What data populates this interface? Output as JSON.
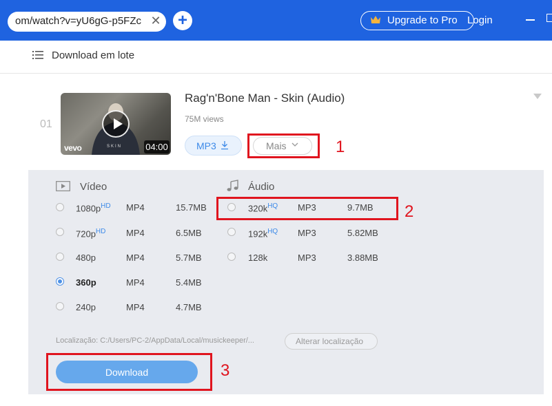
{
  "topbar": {
    "url": "om/watch?v=yU6gG-p5FZc",
    "close_glyph": "✕",
    "add_glyph": "+",
    "upgrade_label": "Upgrade to Pro",
    "login_label": "Login",
    "accent_color": "#1f63e0"
  },
  "batch": {
    "label": "Download em lote"
  },
  "item": {
    "index": "01",
    "title": "Rag'n'Bone Man - Skin (Audio)",
    "views": "75M views",
    "duration": "04:00",
    "thumb_brand": "vevo",
    "thumb_caption": "SKIN",
    "mp3_label": "MP3",
    "mais_label": "Mais"
  },
  "panel": {
    "video_header": "Vídeo",
    "audio_header": "Áudio",
    "video_rows": [
      {
        "quality": "1080p",
        "hq": "HD",
        "format": "MP4",
        "size": "15.7MB",
        "selected": false
      },
      {
        "quality": "720p",
        "hq": "HD",
        "format": "MP4",
        "size": "6.5MB",
        "selected": false
      },
      {
        "quality": "480p",
        "hq": "",
        "format": "MP4",
        "size": "5.7MB",
        "selected": false
      },
      {
        "quality": "360p",
        "hq": "",
        "format": "MP4",
        "size": "5.4MB",
        "selected": true
      },
      {
        "quality": "240p",
        "hq": "",
        "format": "MP4",
        "size": "4.7MB",
        "selected": false
      }
    ],
    "audio_rows": [
      {
        "quality": "320k",
        "hq": "HQ",
        "format": "MP3",
        "size": "9.7MB",
        "selected": false
      },
      {
        "quality": "192k",
        "hq": "HQ",
        "format": "MP3",
        "size": "5.82MB",
        "selected": false
      },
      {
        "quality": "128k",
        "hq": "",
        "format": "MP3",
        "size": "3.88MB",
        "selected": false
      }
    ],
    "location": "Localização: C:/Users/PC-2/AppData/Local/musickeeper/...",
    "alter_label": "Alterar localização",
    "download_label": "Download"
  },
  "annotations": {
    "step1": "1",
    "step2": "2",
    "step3": "3",
    "color": "#e0141e"
  }
}
